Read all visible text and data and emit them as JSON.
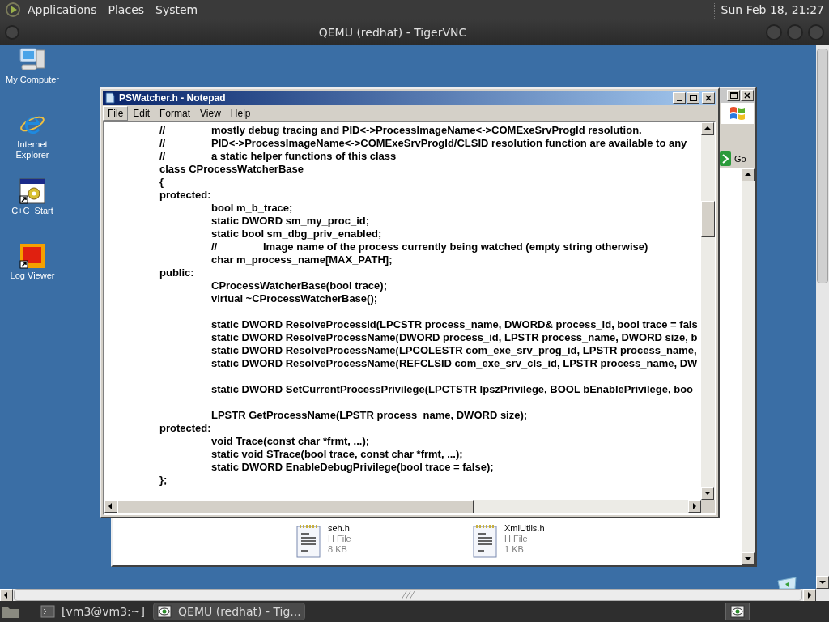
{
  "top_panel": {
    "menus": [
      "Applications",
      "Places",
      "System"
    ],
    "clock": "Sun Feb 18, 21:27"
  },
  "vnc_window": {
    "title": "QEMU (redhat) - TigerVNC"
  },
  "desktop_icons": [
    {
      "label": "My Computer",
      "kind": "computer"
    },
    {
      "label": "Internet Explorer",
      "kind": "browser"
    },
    {
      "label": "C+C_Start",
      "kind": "app"
    },
    {
      "label": "Log Viewer",
      "kind": "viewer"
    }
  ],
  "explorer": {
    "go_button": "Go",
    "files": [
      {
        "name": "seh.h",
        "type": "H File",
        "size": "8 KB"
      },
      {
        "name": "XmlUtils.h",
        "type": "H File",
        "size": "1 KB"
      }
    ]
  },
  "notepad": {
    "title": "PSWatcher.h - Notepad",
    "menu": [
      {
        "label": "File",
        "selected": true
      },
      {
        "label": "Edit",
        "selected": false
      },
      {
        "label": "Format",
        "selected": false
      },
      {
        "label": "View",
        "selected": false
      },
      {
        "label": "Help",
        "selected": false
      }
    ],
    "lines": [
      {
        "kind": "code",
        "text": "\t//\tmostly debug tracing and PID<->ProcessImageName<->COMExeSrvProgId resolution."
      },
      {
        "kind": "code",
        "text": "\t//\tPID<->ProcessImageName<->COMExeSrvProgId/CLSID resolution function are available to any"
      },
      {
        "kind": "code",
        "text": "\t//\ta static helper functions of this class"
      },
      {
        "kind": "code",
        "text": "\tclass CProcessWatcherBase"
      },
      {
        "kind": "code",
        "text": "\t{"
      },
      {
        "kind": "code",
        "text": "\tprotected:"
      },
      {
        "kind": "code",
        "text": "\t\tbool m_b_trace;"
      },
      {
        "kind": "code",
        "text": "\t\tstatic DWORD sm_my_proc_id;"
      },
      {
        "kind": "code",
        "text": "\t\tstatic bool sm_dbg_priv_enabled;"
      },
      {
        "kind": "code",
        "text": "\t\t//\tImage name of the process currently being watched (empty string otherwise)"
      },
      {
        "kind": "code",
        "text": "\t\tchar m_process_name[MAX_PATH];"
      },
      {
        "kind": "code",
        "text": "\tpublic:"
      },
      {
        "kind": "code",
        "text": "\t\tCProcessWatcherBase(bool trace);"
      },
      {
        "kind": "code",
        "text": "\t\tvirtual ~CProcessWatcherBase();"
      },
      {
        "kind": "blank"
      },
      {
        "kind": "code",
        "text": "\t\tstatic DWORD ResolveProcessId(LPCSTR process_name, DWORD& process_id, bool trace = fals"
      },
      {
        "kind": "code",
        "text": "\t\tstatic DWORD ResolveProcessName(DWORD process_id, LPSTR process_name, DWORD size, b"
      },
      {
        "kind": "code",
        "text": "\t\tstatic DWORD ResolveProcessName(LPCOLESTR com_exe_srv_prog_id, LPSTR process_name,"
      },
      {
        "kind": "code",
        "text": "\t\tstatic DWORD ResolveProcessName(REFCLSID com_exe_srv_cls_id, LPSTR process_name, DW"
      },
      {
        "kind": "blank"
      },
      {
        "kind": "code",
        "text": "\t\tstatic DWORD SetCurrentProcessPrivilege(LPCTSTR lpszPrivilege, BOOL bEnablePrivilege, boo"
      },
      {
        "kind": "blank"
      },
      {
        "kind": "code",
        "text": "\t\tLPSTR GetProcessName(LPSTR process_name, DWORD size);"
      },
      {
        "kind": "code",
        "text": "\tprotected:"
      },
      {
        "kind": "code",
        "text": "\t\tvoid Trace(const char *frmt, ...);"
      },
      {
        "kind": "code",
        "text": "\t\tstatic void STrace(bool trace, const char *frmt, ...);"
      },
      {
        "kind": "code",
        "text": "\t\tstatic DWORD EnableDebugPrivilege(bool trace = false);"
      },
      {
        "kind": "code",
        "text": "\t};"
      }
    ]
  },
  "taskbar": {
    "tasks": [
      {
        "label": "[vm3@vm3:~]",
        "kind": "terminal",
        "selected": false
      },
      {
        "label": "QEMU (redhat) - Tig...",
        "kind": "vnc",
        "selected": true
      }
    ]
  }
}
